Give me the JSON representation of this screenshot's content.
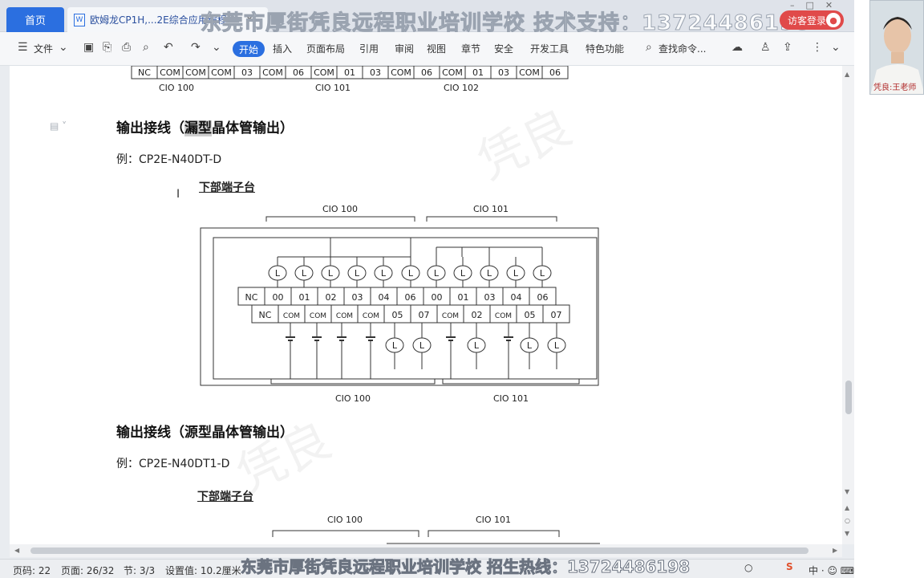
{
  "tabs": {
    "home_label": "首页",
    "doc_label": "欧姆龙CP1H,...2E综合应用编程",
    "doc_icon": "word-doc-icon",
    "add_icon": "plus-icon"
  },
  "watermark_top": "东莞市厚街凭良远程职业培训学校  技术支持：13724486198",
  "watermark_bottom": "东莞市厚街凭良远程职业培训学校  招生热线：13724486198",
  "login_label": "访客登录",
  "toolbar": {
    "menu_label": "文件",
    "active_tab": "开始",
    "tabs": [
      "插入",
      "页面布局",
      "引用",
      "审阅",
      "视图",
      "章节",
      "安全",
      "开发工具",
      "特色功能"
    ],
    "search_label": "查找命令..."
  },
  "document": {
    "top_cio_labels": [
      "CIO 100",
      "CIO 101",
      "CIO 102"
    ],
    "top_terminals": [
      "NC",
      "COM",
      "COM",
      "COM",
      "03",
      "COM",
      "06",
      "COM",
      "01",
      "03",
      "COM",
      "06",
      "COM",
      "01",
      "03",
      "COM",
      "06"
    ],
    "section1_heading_pre": "输出接线（",
    "section1_heading_hl": "漏型",
    "section1_heading_post": "晶体管输出）",
    "section1_example": "例：CP2E-N40DT-D",
    "section1_diagram_title": "下部端子台",
    "diag_cio_top": [
      "CIO 100",
      "CIO 101"
    ],
    "diag_cio_bottom": [
      "CIO 100",
      "CIO 101"
    ],
    "diag_upper_row": [
      "NC",
      "00",
      "01",
      "02",
      "03",
      "04",
      "06",
      "00",
      "01",
      "03",
      "04",
      "06"
    ],
    "diag_lower_row": [
      "NC",
      "COM",
      "COM",
      "COM",
      "COM",
      "05",
      "07",
      "COM",
      "02",
      "COM",
      "05",
      "07"
    ],
    "load_label": "L",
    "section2_heading": "输出接线（源型晶体管输出）",
    "section2_example": "例：CP2E-N40DT1-D",
    "section2_diagram_title": "下部端子台",
    "diag2_cio_top": [
      "CIO 100",
      "CIO 101"
    ]
  },
  "status": {
    "page_code": "页码: 22",
    "page": "页面: 26/32",
    "section": "节: 3/3",
    "setting": "设置值: 10.2厘米"
  },
  "webcam_caption": "凭良:王老师"
}
